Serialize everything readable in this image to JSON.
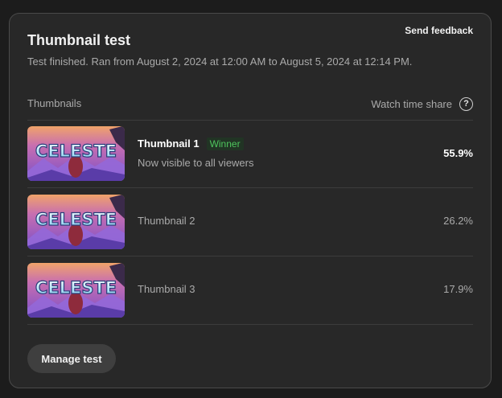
{
  "card": {
    "title": "Thumbnail test",
    "feedback_label": "Send feedback",
    "subtitle": "Test finished. Ran from August 2, 2024 at 12:00 AM to August 5, 2024 at 12:14 PM."
  },
  "table": {
    "col_thumbnails": "Thumbnails",
    "col_watch_time": "Watch time share",
    "help_icon_glyph": "?",
    "rows": [
      {
        "name": "Thumbnail 1",
        "badge": "Winner",
        "status": "Now visible to all viewers",
        "share": "55.9%",
        "thumb_text": "CELESTE"
      },
      {
        "name": "Thumbnail 2",
        "share": "26.2%",
        "thumb_text": "CELESTE"
      },
      {
        "name": "Thumbnail 3",
        "share": "17.9%",
        "thumb_text": "CELESTE"
      }
    ]
  },
  "manage_label": "Manage test",
  "colors": {
    "background": "#282828",
    "border": "#4a4a4a",
    "winner_green": "#4ec55d",
    "button_bg": "#3f3f3f"
  },
  "icons": {
    "help": "help-circle-icon"
  }
}
